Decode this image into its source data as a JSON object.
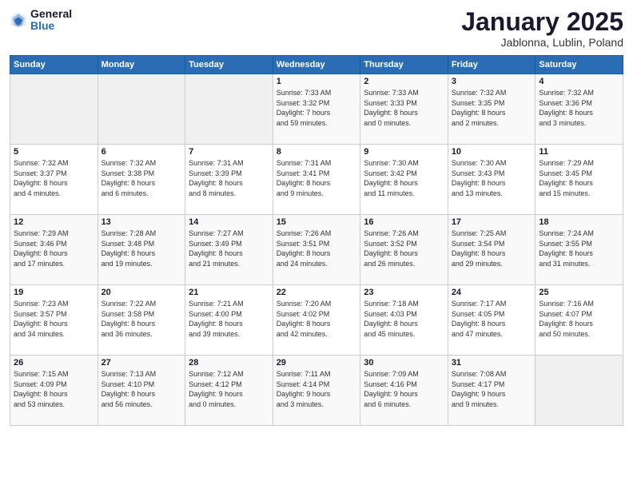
{
  "logo": {
    "general": "General",
    "blue": "Blue"
  },
  "header": {
    "title": "January 2025",
    "subtitle": "Jablonna, Lublin, Poland"
  },
  "weekdays": [
    "Sunday",
    "Monday",
    "Tuesday",
    "Wednesday",
    "Thursday",
    "Friday",
    "Saturday"
  ],
  "weeks": [
    [
      {
        "day": "",
        "info": ""
      },
      {
        "day": "",
        "info": ""
      },
      {
        "day": "",
        "info": ""
      },
      {
        "day": "1",
        "info": "Sunrise: 7:33 AM\nSunset: 3:32 PM\nDaylight: 7 hours\nand 59 minutes."
      },
      {
        "day": "2",
        "info": "Sunrise: 7:33 AM\nSunset: 3:33 PM\nDaylight: 8 hours\nand 0 minutes."
      },
      {
        "day": "3",
        "info": "Sunrise: 7:32 AM\nSunset: 3:35 PM\nDaylight: 8 hours\nand 2 minutes."
      },
      {
        "day": "4",
        "info": "Sunrise: 7:32 AM\nSunset: 3:36 PM\nDaylight: 8 hours\nand 3 minutes."
      }
    ],
    [
      {
        "day": "5",
        "info": "Sunrise: 7:32 AM\nSunset: 3:37 PM\nDaylight: 8 hours\nand 4 minutes."
      },
      {
        "day": "6",
        "info": "Sunrise: 7:32 AM\nSunset: 3:38 PM\nDaylight: 8 hours\nand 6 minutes."
      },
      {
        "day": "7",
        "info": "Sunrise: 7:31 AM\nSunset: 3:39 PM\nDaylight: 8 hours\nand 8 minutes."
      },
      {
        "day": "8",
        "info": "Sunrise: 7:31 AM\nSunset: 3:41 PM\nDaylight: 8 hours\nand 9 minutes."
      },
      {
        "day": "9",
        "info": "Sunrise: 7:30 AM\nSunset: 3:42 PM\nDaylight: 8 hours\nand 11 minutes."
      },
      {
        "day": "10",
        "info": "Sunrise: 7:30 AM\nSunset: 3:43 PM\nDaylight: 8 hours\nand 13 minutes."
      },
      {
        "day": "11",
        "info": "Sunrise: 7:29 AM\nSunset: 3:45 PM\nDaylight: 8 hours\nand 15 minutes."
      }
    ],
    [
      {
        "day": "12",
        "info": "Sunrise: 7:29 AM\nSunset: 3:46 PM\nDaylight: 8 hours\nand 17 minutes."
      },
      {
        "day": "13",
        "info": "Sunrise: 7:28 AM\nSunset: 3:48 PM\nDaylight: 8 hours\nand 19 minutes."
      },
      {
        "day": "14",
        "info": "Sunrise: 7:27 AM\nSunset: 3:49 PM\nDaylight: 8 hours\nand 21 minutes."
      },
      {
        "day": "15",
        "info": "Sunrise: 7:26 AM\nSunset: 3:51 PM\nDaylight: 8 hours\nand 24 minutes."
      },
      {
        "day": "16",
        "info": "Sunrise: 7:26 AM\nSunset: 3:52 PM\nDaylight: 8 hours\nand 26 minutes."
      },
      {
        "day": "17",
        "info": "Sunrise: 7:25 AM\nSunset: 3:54 PM\nDaylight: 8 hours\nand 29 minutes."
      },
      {
        "day": "18",
        "info": "Sunrise: 7:24 AM\nSunset: 3:55 PM\nDaylight: 8 hours\nand 31 minutes."
      }
    ],
    [
      {
        "day": "19",
        "info": "Sunrise: 7:23 AM\nSunset: 3:57 PM\nDaylight: 8 hours\nand 34 minutes."
      },
      {
        "day": "20",
        "info": "Sunrise: 7:22 AM\nSunset: 3:58 PM\nDaylight: 8 hours\nand 36 minutes."
      },
      {
        "day": "21",
        "info": "Sunrise: 7:21 AM\nSunset: 4:00 PM\nDaylight: 8 hours\nand 39 minutes."
      },
      {
        "day": "22",
        "info": "Sunrise: 7:20 AM\nSunset: 4:02 PM\nDaylight: 8 hours\nand 42 minutes."
      },
      {
        "day": "23",
        "info": "Sunrise: 7:18 AM\nSunset: 4:03 PM\nDaylight: 8 hours\nand 45 minutes."
      },
      {
        "day": "24",
        "info": "Sunrise: 7:17 AM\nSunset: 4:05 PM\nDaylight: 8 hours\nand 47 minutes."
      },
      {
        "day": "25",
        "info": "Sunrise: 7:16 AM\nSunset: 4:07 PM\nDaylight: 8 hours\nand 50 minutes."
      }
    ],
    [
      {
        "day": "26",
        "info": "Sunrise: 7:15 AM\nSunset: 4:09 PM\nDaylight: 8 hours\nand 53 minutes."
      },
      {
        "day": "27",
        "info": "Sunrise: 7:13 AM\nSunset: 4:10 PM\nDaylight: 8 hours\nand 56 minutes."
      },
      {
        "day": "28",
        "info": "Sunrise: 7:12 AM\nSunset: 4:12 PM\nDaylight: 9 hours\nand 0 minutes."
      },
      {
        "day": "29",
        "info": "Sunrise: 7:11 AM\nSunset: 4:14 PM\nDaylight: 9 hours\nand 3 minutes."
      },
      {
        "day": "30",
        "info": "Sunrise: 7:09 AM\nSunset: 4:16 PM\nDaylight: 9 hours\nand 6 minutes."
      },
      {
        "day": "31",
        "info": "Sunrise: 7:08 AM\nSunset: 4:17 PM\nDaylight: 9 hours\nand 9 minutes."
      },
      {
        "day": "",
        "info": ""
      }
    ]
  ]
}
